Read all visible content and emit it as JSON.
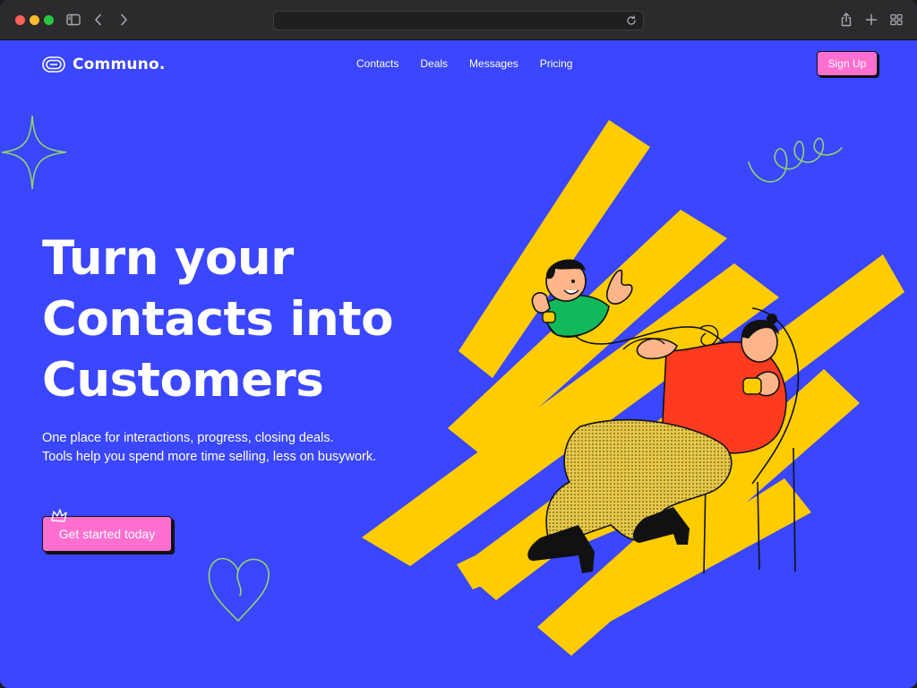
{
  "browser": {
    "address": ""
  },
  "brand": {
    "name": "Communo."
  },
  "nav": {
    "items": [
      "Contacts",
      "Deals",
      "Messages",
      "Pricing"
    ]
  },
  "header": {
    "signup_label": "Sign Up"
  },
  "hero": {
    "headline": [
      "Turn your",
      "Contacts into",
      "Customers"
    ],
    "subtext": [
      "One place for interactions, progress, closing deals.",
      "Tools help you spend more time selling, less on busywork."
    ],
    "cta_label": "Get started today"
  },
  "colors": {
    "background": "#3a46ff",
    "accent_pink": "#ff6fd0",
    "accent_yellow": "#ffcc00",
    "doodle_green": "#8fd46b"
  },
  "icons": {
    "sidebar": "sidebar-icon",
    "back": "chevron-left-icon",
    "forward": "chevron-right-icon",
    "reload": "reload-icon",
    "share": "share-icon",
    "new_tab": "plus-icon",
    "tab_overview": "grid-icon"
  }
}
